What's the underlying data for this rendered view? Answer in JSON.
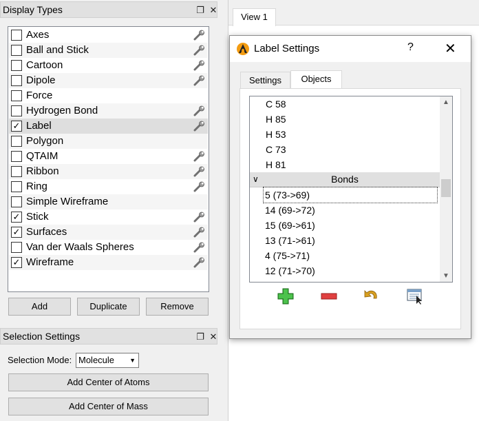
{
  "display_types": {
    "title": "Display Types",
    "items": [
      {
        "label": "Axes",
        "checked": false,
        "wrench": true
      },
      {
        "label": "Ball and Stick",
        "checked": false,
        "wrench": true
      },
      {
        "label": "Cartoon",
        "checked": false,
        "wrench": true
      },
      {
        "label": "Dipole",
        "checked": false,
        "wrench": true
      },
      {
        "label": "Force",
        "checked": false,
        "wrench": false
      },
      {
        "label": "Hydrogen Bond",
        "checked": false,
        "wrench": true
      },
      {
        "label": "Label",
        "checked": true,
        "wrench": true
      },
      {
        "label": "Polygon",
        "checked": false,
        "wrench": false
      },
      {
        "label": "QTAIM",
        "checked": false,
        "wrench": true
      },
      {
        "label": "Ribbon",
        "checked": false,
        "wrench": true
      },
      {
        "label": "Ring",
        "checked": false,
        "wrench": true
      },
      {
        "label": "Simple Wireframe",
        "checked": false,
        "wrench": false
      },
      {
        "label": "Stick",
        "checked": true,
        "wrench": true
      },
      {
        "label": "Surfaces",
        "checked": true,
        "wrench": true
      },
      {
        "label": "Van der Waals Spheres",
        "checked": false,
        "wrench": true
      },
      {
        "label": "Wireframe",
        "checked": true,
        "wrench": true
      }
    ],
    "add_label": "Add",
    "duplicate_label": "Duplicate",
    "remove_label": "Remove"
  },
  "selection_settings": {
    "title": "Selection Settings",
    "mode_label": "Selection Mode:",
    "mode_value": "Molecule",
    "add_center_atoms_label": "Add Center of Atoms",
    "add_center_mass_label": "Add Center of Mass"
  },
  "view": {
    "tab_label": "View 1"
  },
  "dialog": {
    "title": "Label Settings",
    "help": "?",
    "close": "✕",
    "tabs": [
      {
        "label": "Settings"
      },
      {
        "label": "Objects"
      }
    ],
    "tree": {
      "atoms": [
        "C 58",
        "H 85",
        "H 53",
        "C 73",
        "H 81"
      ],
      "bonds_header": "Bonds",
      "bonds": [
        "5 (73->69)",
        "14 (69->72)",
        "15 (69->61)",
        "13 (71->61)",
        "4 (75->71)",
        "12 (71->70)"
      ]
    }
  },
  "icons": {
    "wrench": "wrench-icon",
    "add": "add-icon",
    "remove": "remove-icon",
    "undo": "undo-icon",
    "select": "select-icon"
  },
  "colors": {
    "selected_row": "#dedede",
    "add_green": "#3aa83a",
    "remove_red": "#e04040",
    "undo_gold": "#d9a020"
  }
}
